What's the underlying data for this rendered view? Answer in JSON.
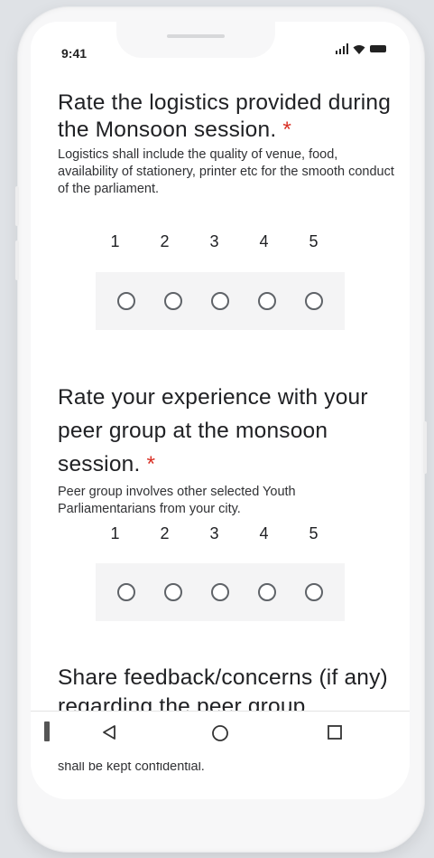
{
  "status_bar": {
    "time": "9:41"
  },
  "questions": [
    {
      "title": "Rate the logistics provided during the Monsoon session.",
      "required_marker": "*",
      "description": "Logistics shall include the quality of venue, food, availability of stationery, printer etc for the smooth conduct of the parliament.",
      "scale": [
        "1",
        "2",
        "3",
        "4",
        "5"
      ]
    },
    {
      "title": "Rate your experience with your peer group at the monsoon session.",
      "required_marker": "*",
      "description": "Peer group involves other selected Youth Parliamentarians from your city.",
      "scale": [
        "1",
        "2",
        "3",
        "4",
        "5"
      ]
    },
    {
      "title": "Share feedback/concerns (if any) regarding the peer group.",
      "description": "You may let us know if you are facing any challenges/concerns with the peer group. Your response shall be kept confidential."
    }
  ],
  "nav": {
    "back": "back-triangle-icon",
    "home": "home-circle-icon",
    "recents": "recents-square-icon"
  },
  "colors": {
    "required": "#d93025",
    "radio_border": "#5f6368",
    "scale_bg": "#f4f4f5"
  }
}
